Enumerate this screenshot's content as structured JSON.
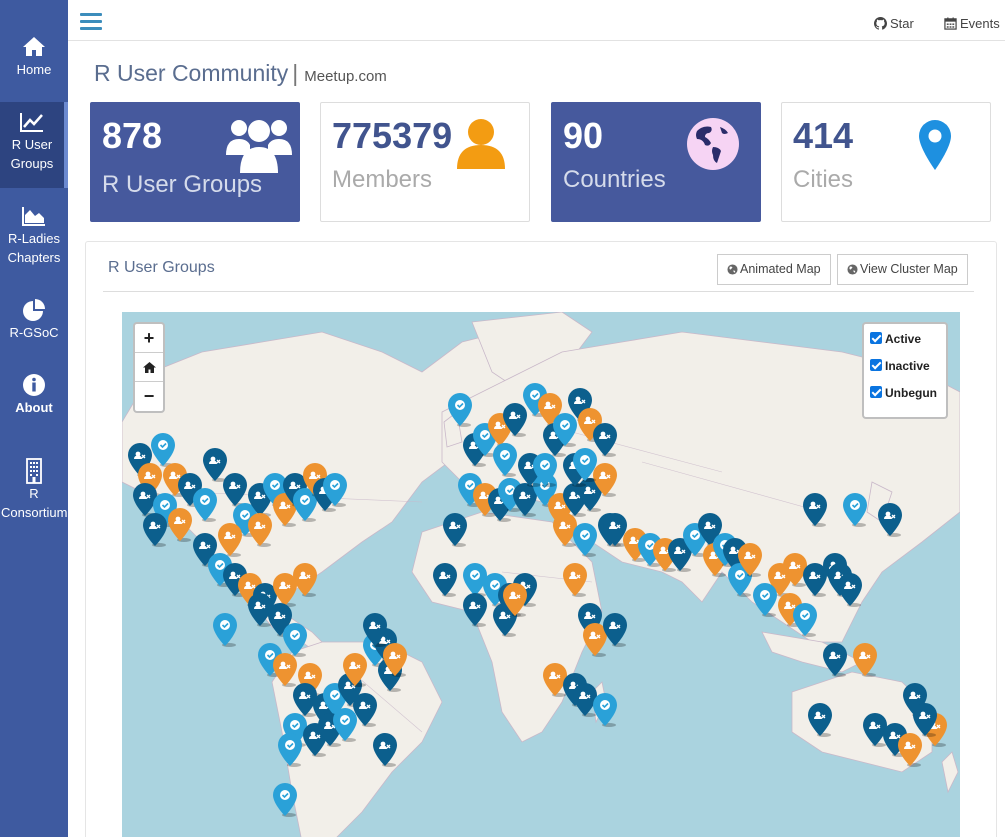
{
  "sidebar": {
    "items": [
      {
        "label": "Home",
        "icon": "home-icon"
      },
      {
        "label": "R User Groups",
        "icon": "line-chart-icon"
      },
      {
        "label": "R-Ladies Chapters",
        "icon": "area-chart-icon"
      },
      {
        "label": "R-GSoC",
        "icon": "pie-chart-icon"
      },
      {
        "label": "About",
        "icon": "info-icon"
      },
      {
        "label": "R Consortium",
        "icon": "building-icon"
      }
    ]
  },
  "topbar": {
    "star_label": "Star",
    "events_label": "Events"
  },
  "header": {
    "title": "R User Community",
    "separator": "|",
    "subtitle": "Meetup.com"
  },
  "stats": [
    {
      "value": "878",
      "label": "R User Groups",
      "icon": "users-icon",
      "color": "#46599d"
    },
    {
      "value": "775379",
      "label": "Members",
      "icon": "user-icon",
      "color": "#f39c12"
    },
    {
      "value": "90",
      "label": "Countries",
      "icon": "globe-icon",
      "color": "#46599d"
    },
    {
      "value": "414",
      "label": "Cities",
      "icon": "map-pin-icon",
      "color": "#1e90e0"
    }
  ],
  "mapbox": {
    "title": "R User Groups",
    "animated_map_label": "Animated Map",
    "cluster_map_label": "View Cluster Map"
  },
  "map": {
    "zoom_in": "+",
    "zoom_out": "−",
    "legend": [
      {
        "label": "Active",
        "checked": true
      },
      {
        "label": "Inactive",
        "checked": true
      },
      {
        "label": "Unbegun",
        "checked": true
      }
    ],
    "marker_colors": {
      "active": "#2aa1d8",
      "inactive": "#0c5f8d",
      "unbegun": "#ee9330"
    }
  }
}
